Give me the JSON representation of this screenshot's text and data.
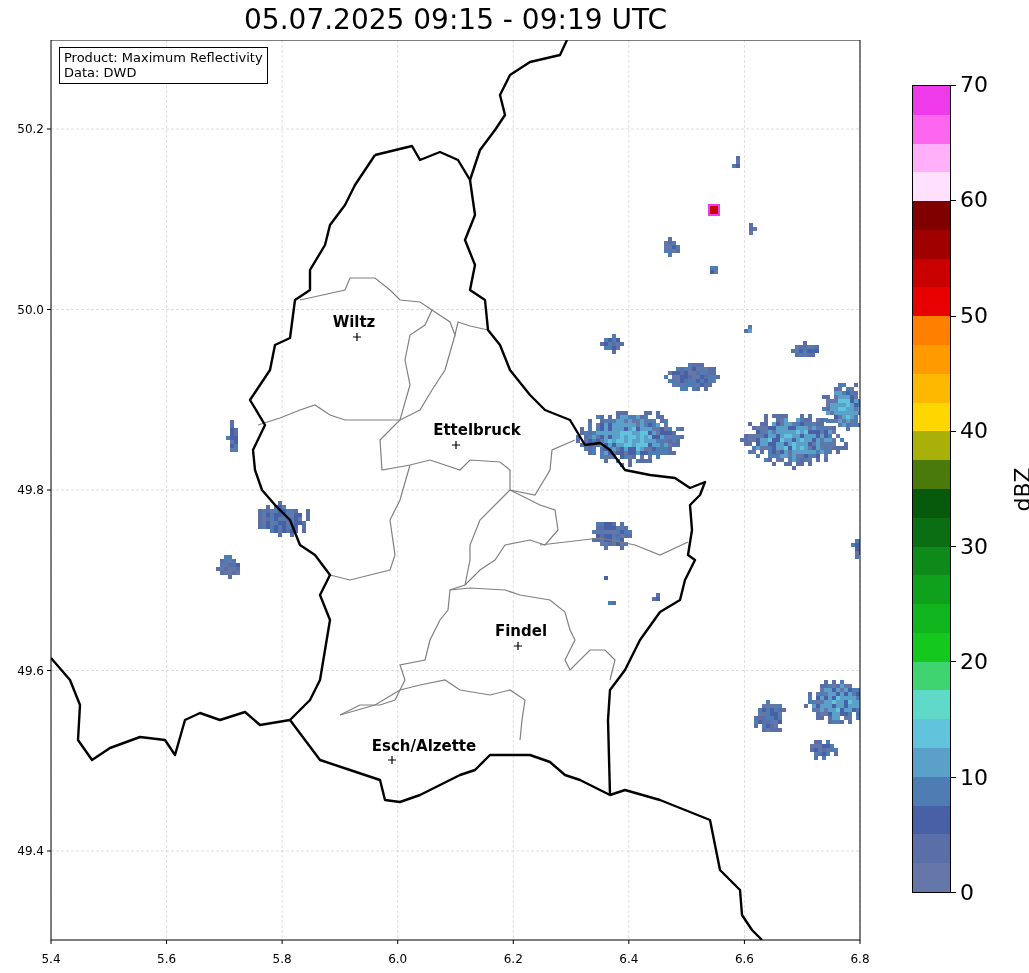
{
  "title": "05.07.2025 09:15 - 09:19 UTC",
  "info_box": [
    "Product: Maximum Reflectivity",
    "Data: DWD"
  ],
  "map": {
    "x_ticks": [
      "5.4",
      "5.6",
      "5.8",
      "6.0",
      "6.2",
      "6.4",
      "6.6",
      "6.8"
    ],
    "y_ticks": [
      "50.2",
      "50.0",
      "49.8",
      "49.6",
      "49.4"
    ],
    "cities": [
      {
        "name": "Wiltz"
      },
      {
        "name": "Ettelbruck"
      },
      {
        "name": "Findel"
      },
      {
        "name": "Esch/Alzette"
      }
    ]
  },
  "colorbar": {
    "label": "dBZ",
    "ticks": [
      "70",
      "60",
      "50",
      "40",
      "30",
      "20",
      "10",
      "0"
    ],
    "segments": [
      {
        "color": "#6577a8"
      },
      {
        "color": "#5a6ea8"
      },
      {
        "color": "#4860a6"
      },
      {
        "color": "#4e7db3"
      },
      {
        "color": "#5aa0c8"
      },
      {
        "color": "#62c3dc"
      },
      {
        "color": "#60d9c8"
      },
      {
        "color": "#3fd46f"
      },
      {
        "color": "#14c81e"
      },
      {
        "color": "#10b51e"
      },
      {
        "color": "#0fa01c"
      },
      {
        "color": "#0e8a1a"
      },
      {
        "color": "#0a6e12"
      },
      {
        "color": "#075a0b"
      },
      {
        "color": "#4a7a0a"
      },
      {
        "color": "#aab00a"
      },
      {
        "color": "#ffd700"
      },
      {
        "color": "#ffb800"
      },
      {
        "color": "#ff9a00"
      },
      {
        "color": "#ff7f00"
      },
      {
        "color": "#e60000"
      },
      {
        "color": "#c80000"
      },
      {
        "color": "#a00000"
      },
      {
        "color": "#800000"
      },
      {
        "color": "#ffe0ff"
      },
      {
        "color": "#ffb0f8"
      },
      {
        "color": "#ff66f0"
      },
      {
        "color": "#ee3ae8"
      }
    ]
  }
}
